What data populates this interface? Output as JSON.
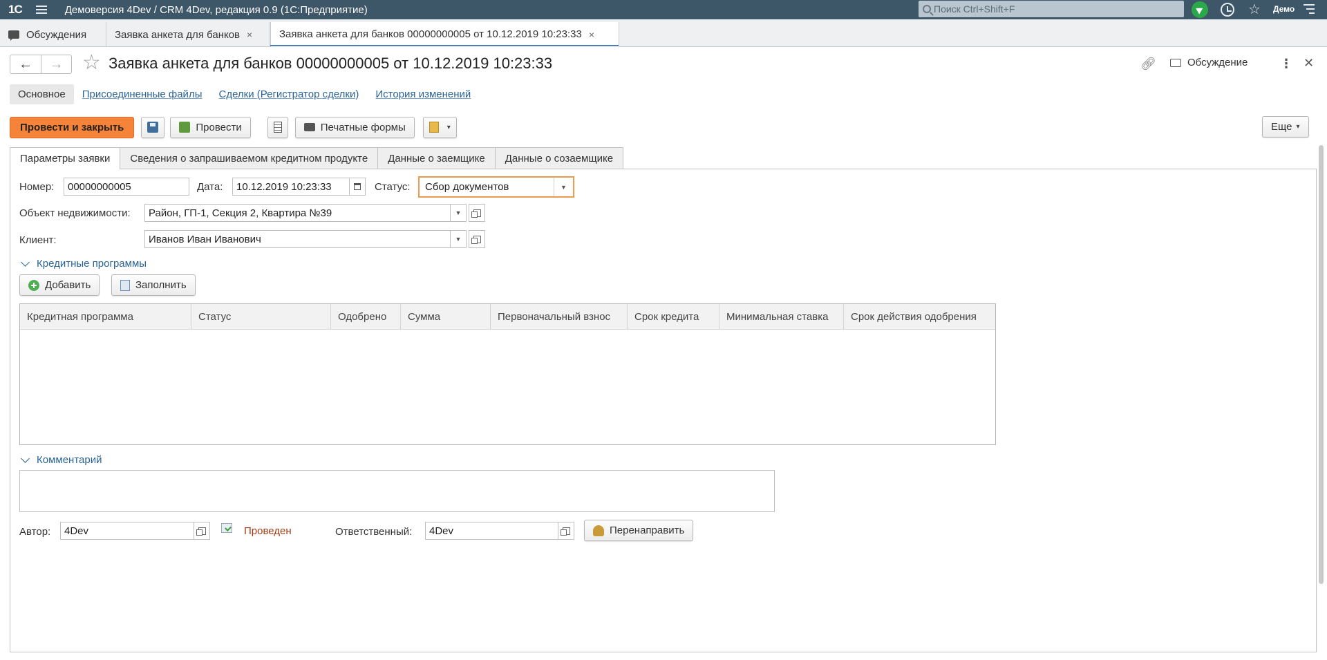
{
  "app": {
    "logo": "1С",
    "title": "Демоверсия 4Dev / CRM 4Dev, редакция 0.9   (1С:Предприятие)",
    "search_placeholder": "Поиск Ctrl+Shift+F",
    "user": "Демо"
  },
  "window_tabs": [
    {
      "label": "Обсуждения",
      "icon": "chat-icon"
    },
    {
      "label": "Заявка анкета для банков",
      "close": "×"
    },
    {
      "label": "Заявка анкета для банков 00000000005 от 10.12.2019 10:23:33",
      "close": "×",
      "active": true
    }
  ],
  "form": {
    "title": "Заявка анкета для банков 00000000005 от 10.12.2019 10:23:33",
    "discussion_label": "Обсуждение"
  },
  "section_nav": [
    "Основное",
    "Присоединенные файлы",
    "Сделки (Регистратор сделки)",
    "История изменений"
  ],
  "toolbar": {
    "post_close": "Провести и закрыть",
    "post": "Провести",
    "print_forms": "Печатные формы",
    "more": "Еще"
  },
  "tabs": [
    "Параметры заявки",
    "Сведения о запрашиваемом кредитном продукте",
    "Данные о заемщике",
    "Данные о созаемщике"
  ],
  "fields": {
    "number_label": "Номер:",
    "number_value": "00000000005",
    "date_label": "Дата:",
    "date_value": "10.12.2019 10:23:33",
    "status_label": "Статус:",
    "status_value": "Сбор документов",
    "property_label": "Объект недвижимости:",
    "property_value": "Район, ГП-1, Секция 2, Квартира №39",
    "client_label": "Клиент:",
    "client_value": "Иванов Иван Иванович"
  },
  "credit_programs": {
    "group_title": "Кредитные программы",
    "add": "Добавить",
    "fill": "Заполнить",
    "columns": [
      "Кредитная программа",
      "Статус",
      "Одобрено",
      "Сумма",
      "Первоначальный взнос",
      "Срок кредита",
      "Минимальная ставка",
      "Срок действия одобрения"
    ],
    "rows": []
  },
  "comment": {
    "group_title": "Комментарий",
    "value": ""
  },
  "footer": {
    "author_label": "Автор:",
    "author_value": "4Dev",
    "posted_status": "Проведен",
    "responsible_label": "Ответственный:",
    "responsible_value": "4Dev",
    "redirect": "Перенаправить"
  },
  "colors": {
    "topbar": "#3d5668",
    "primary_button": "#f5843a",
    "link": "#2a6496",
    "status_border": "#ee9a4d",
    "posted_text": "#a23c12"
  }
}
